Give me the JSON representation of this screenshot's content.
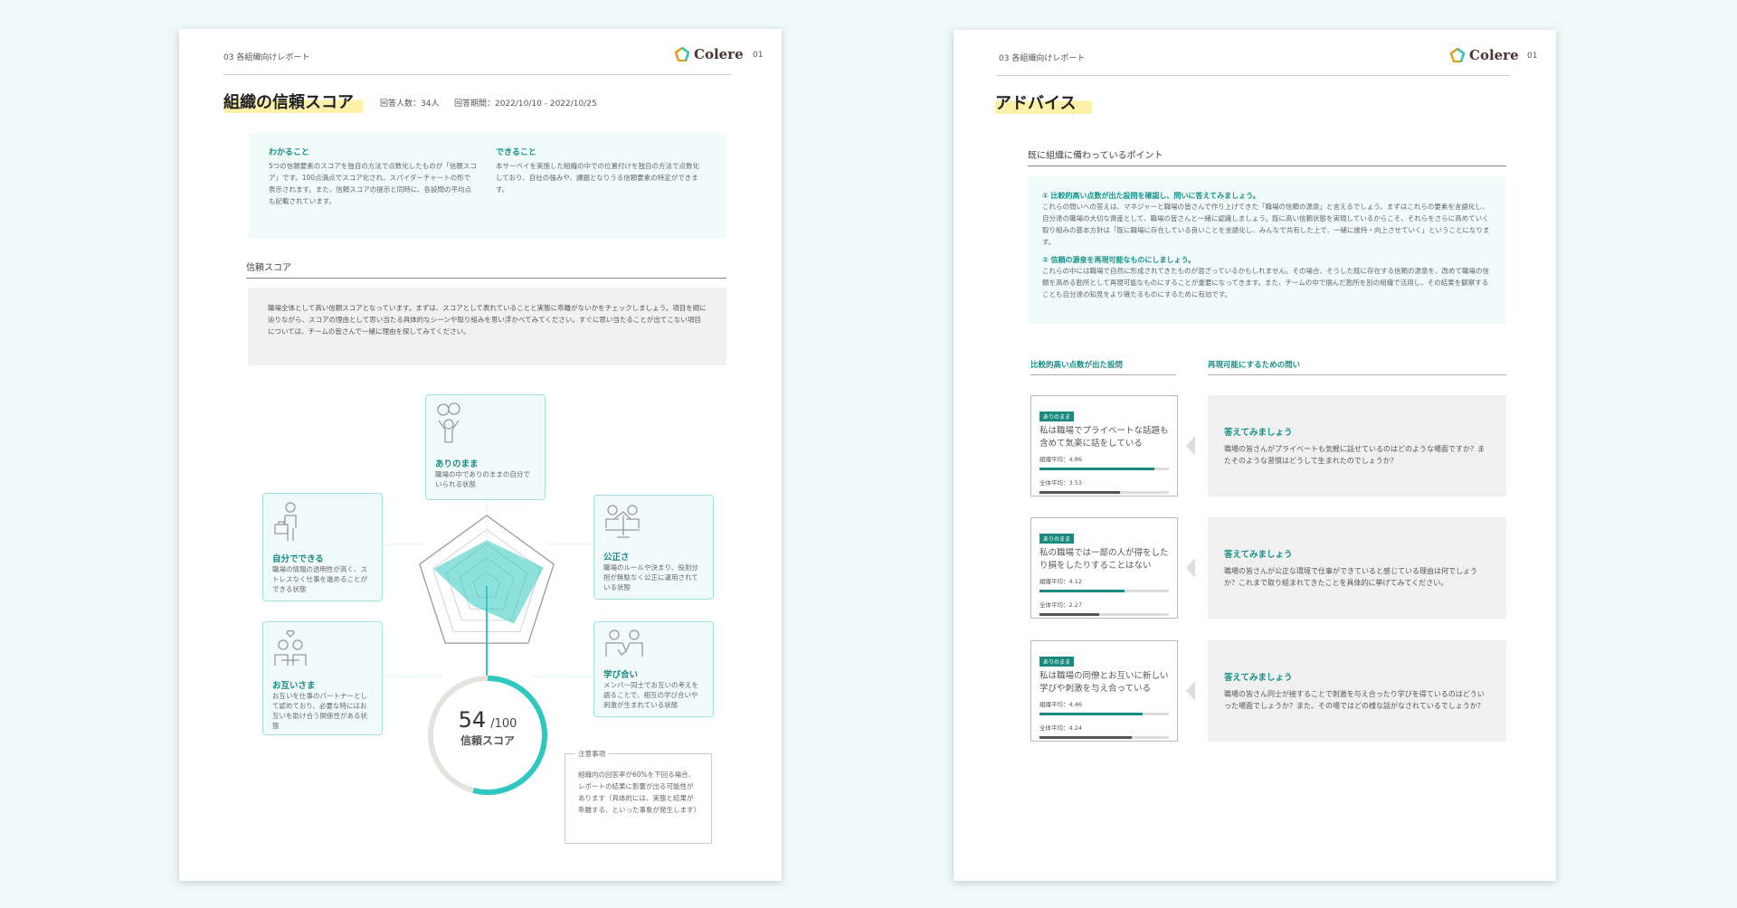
{
  "brand": {
    "name": "Colere",
    "accent": "#2ec8c0",
    "dark_teal": "#1a8a80",
    "highlight": "#fdf0a8"
  },
  "left_page": {
    "section_label": "03 各組織向けレポート",
    "page_number": "01",
    "title": "組織の信頼スコア",
    "respondents": "回答人数：34人",
    "period": "回答期間：2022/10/10 - 2022/10/25",
    "info": [
      {
        "heading": "わかること",
        "text": "5つの信頼要素のスコアを独自の方法で点数化したものが「信頼スコア」です。100点満点でスコア化され、スパイダーチャートの形で表示されます。また、信頼スコアの提示と同時に、各設問の平均点も記載されています。"
      },
      {
        "heading": "できること",
        "text": "本サーベイを実施した組織の中での位置付けを独自の方法で点数化しており、自社の強みや、課題となりうる信頼要素の特定ができます。"
      }
    ],
    "score_heading": "信頼スコア",
    "score_comment": "職場全体として高い信頼スコアとなっています。まずは、スコアとして表れていることと実態に乖離がないかをチェックしましょう。項目を順に辿りながら、スコアの理由として思い当たる具体的なシーンや取り組みを思い浮かべてみてください。すぐに思い当たることが出てこない項目については、チームの皆さんで一緒に理由を探してみてください。",
    "elements": [
      {
        "title": "ありのまま",
        "desc": "職場の中でありのままの自分でいられる状態",
        "icon": "masks-person-icon"
      },
      {
        "title": "公正さ",
        "desc": "職場のルールや決まり、役割分担が無駄なく公正に運用されている状態",
        "icon": "scales-people-icon"
      },
      {
        "title": "学び合い",
        "desc": "メンバー同士でお互いの考えを語ることで、相互の学び合いや刺激が生まれている状態",
        "icon": "people-holding-hands-icon"
      },
      {
        "title": "お互いさま",
        "desc": "お互いを仕事のパートナーとして認めており、必要な時にはお互いを助け合う関係性がある状態",
        "icon": "people-heart-icon"
      },
      {
        "title": "自分でできる",
        "desc": "職場の情報の透明性が高く、ストレスなく仕事を進めることができる状態",
        "icon": "person-briefcase-icon"
      }
    ],
    "score": {
      "value": "54",
      "max": "/100",
      "label": "信頼スコア",
      "fraction": 0.54
    },
    "note": {
      "title": "注意事項",
      "text": "組織内の回答率が60%を下回る場合、レポートの結果に影響が出る可能性があります（具体的には、実態と結果が乖離する、といった事象が発生します）"
    }
  },
  "chart_data": {
    "type": "radar",
    "categories": [
      "ありのまま",
      "公正さ",
      "学び合い",
      "お互いさま",
      "自分でできる"
    ],
    "values": [
      0.65,
      0.85,
      0.66,
      0.34,
      0.79
    ],
    "range": [
      0,
      1
    ],
    "rings": 5,
    "grid": true
  },
  "right_page": {
    "section_label": "03 各組織向けレポート",
    "page_number": "01",
    "title": "アドバイス",
    "subtitle": "既に組織に備わっているポイント",
    "points": [
      {
        "heading": "① 比較的高い点数が出た設問を確認し、問いに答えてみましょう。",
        "text": "これらの問いへの答えは、マネジャーと職場の皆さんで作り上げてきた「職場の信頼の源泉」と言えるでしょう。まずはこれらの要素を言語化し、自分達の職場の大切な資産として、職場の皆さんと一緒に認識しましょう。既に高い信頼状態を実現しているからこそ、それらをさらに高めていく取り組みの基本方針は「既に職場に存在している良いことを言語化し、みんなで共有した上で、一緒に維持・向上させていく」ということになります。"
      },
      {
        "heading": "② 信頼の源泉を再現可能なものにしましょう。",
        "text": "これらの中には職場で自然に形成されてきたものが混ざっているかもしれません。その場合、そうした既に存在する信頼の源泉を、改めて職場の信頼を高める勘所として再現可能なものにすることが重要になってきます。また、チームの中で掴んだ勘所を別の組織で活用し、その結果を観察することも自分達の知見をより確たるものにするために有効です。"
      }
    ],
    "col_left": "比較的高い点数が出た設問",
    "col_right": "再現可能にするための問い",
    "rows": [
      {
        "tag": "ありのまま",
        "question": "私は職場でプライベートな話題も含めて気楽に話をしている",
        "org_label": "組織平均：4.86",
        "org_fill": 0.89,
        "all_label": "全体平均：3.53",
        "all_fill": 0.62,
        "answer_title": "答えてみましょう",
        "answer": "職場の皆さんがプライベートも気軽に話せているのはどのような場面ですか？またそのような習慣はどうして生まれたのでしょうか？"
      },
      {
        "tag": "ありのまま",
        "question": "私の職場では一部の人が得をしたり損をしたりすることはない",
        "org_label": "組織平均：4.12",
        "org_fill": 0.66,
        "all_label": "全体平均：2.27",
        "all_fill": 0.46,
        "answer_title": "答えてみましょう",
        "answer": "職場の皆さんが公正な環境で仕事ができていると感じている理由は何でしょうか？これまで取り組まれてきたことを具体的に挙げてみてください。"
      },
      {
        "tag": "ありのまま",
        "question": "私は職場の同僚とお互いに新しい学びや刺激を与え合っている",
        "org_label": "組織平均：4.46",
        "org_fill": 0.8,
        "all_label": "全体平均：4.24",
        "all_fill": 0.71,
        "answer_title": "答えてみましょう",
        "answer": "職場の皆さん同士が接することで刺激を与え合ったり学びを得ているのはどういった場面でしょうか？また、その場ではどの様な話がなされているでしょうか？"
      }
    ]
  }
}
